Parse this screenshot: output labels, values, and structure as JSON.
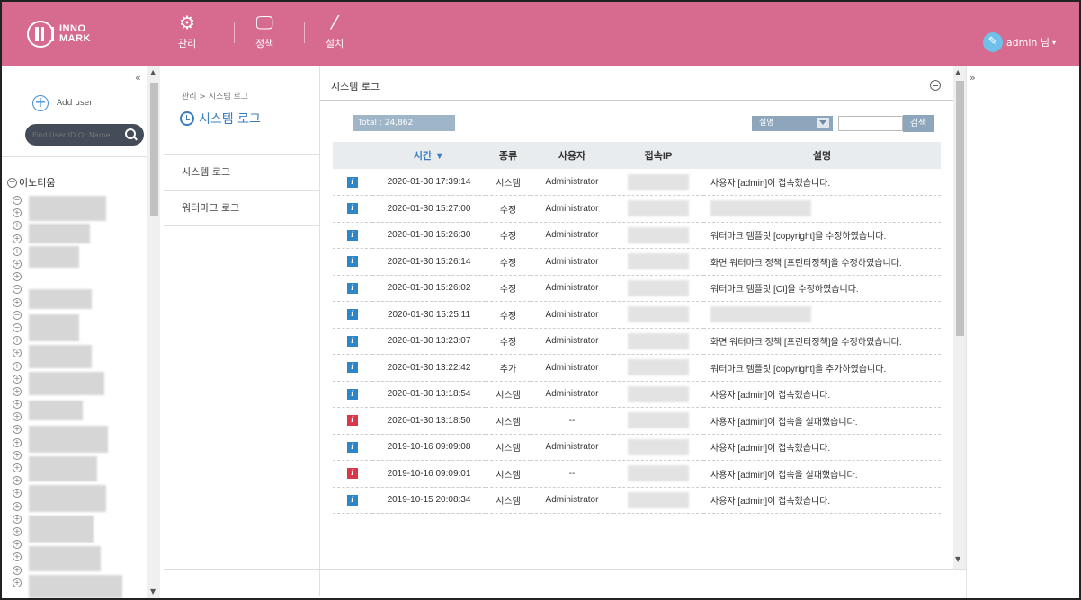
{
  "header": {
    "logo_line1": "INNO",
    "logo_line2": "MARK",
    "nav": [
      {
        "label": "관리",
        "icon": "gear-icon"
      },
      {
        "label": "정책",
        "icon": "monitor-icon"
      },
      {
        "label": "설치",
        "icon": "wand-icon"
      }
    ],
    "user_label": "admin 님",
    "accent_color": "#d66a8f"
  },
  "sidebar": {
    "add_user_label": "Add user",
    "search_placeholder": "Find User ID Or Name",
    "root_label": "이노티움"
  },
  "middle": {
    "breadcrumb": "관리 > 시스템 로그",
    "title": "시스템 로그",
    "menu": [
      "시스템 로그",
      "워터마크 로그"
    ]
  },
  "main": {
    "title": "시스템 로그",
    "total": "Total : 24,862",
    "filter_select": "설명",
    "search_button": "검색",
    "columns": {
      "time": "시간 ▼",
      "type": "종류",
      "user": "사용자",
      "ip": "접속IP",
      "desc": "설명"
    },
    "rows": [
      {
        "level": "info",
        "time": "2020-01-30 17:39:14",
        "type": "시스템",
        "user": "Administrator",
        "desc": "사용자 [admin]이 접속했습니다."
      },
      {
        "level": "info",
        "time": "2020-01-30 15:27:00",
        "type": "수정",
        "user": "Administrator",
        "desc": ""
      },
      {
        "level": "info",
        "time": "2020-01-30 15:26:30",
        "type": "수정",
        "user": "Administrator",
        "desc": "워터마크 템플릿 [copyright]을 수정하였습니다."
      },
      {
        "level": "info",
        "time": "2020-01-30 15:26:14",
        "type": "수정",
        "user": "Administrator",
        "desc": "화면 워터마크 정책 [프린터정책]을 수정하였습니다."
      },
      {
        "level": "info",
        "time": "2020-01-30 15:26:02",
        "type": "수정",
        "user": "Administrator",
        "desc": "워터마크 템플릿 [CI]을 수정하였습니다."
      },
      {
        "level": "info",
        "time": "2020-01-30 15:25:11",
        "type": "수정",
        "user": "Administrator",
        "desc": ""
      },
      {
        "level": "info",
        "time": "2020-01-30 13:23:07",
        "type": "수정",
        "user": "Administrator",
        "desc": "화면 워터마크 정책 [프린터정책]을 수정하였습니다."
      },
      {
        "level": "info",
        "time": "2020-01-30 13:22:42",
        "type": "추가",
        "user": "Administrator",
        "desc": "워터마크 템플릿 [copyright]을 추가하였습니다."
      },
      {
        "level": "info",
        "time": "2020-01-30 13:18:54",
        "type": "시스템",
        "user": "Administrator",
        "desc": "사용자 [admin]이 접속했습니다."
      },
      {
        "level": "error",
        "time": "2020-01-30 13:18:50",
        "type": "시스템",
        "user": "--",
        "desc": "사용자 [admin]이 접속을 실패했습니다."
      },
      {
        "level": "info",
        "time": "2019-10-16 09:09:08",
        "type": "시스템",
        "user": "Administrator",
        "desc": "사용자 [admin]이 접속했습니다."
      },
      {
        "level": "error",
        "time": "2019-10-16 09:09:01",
        "type": "시스템",
        "user": "--",
        "desc": "사용자 [admin]이 접속을 실패했습니다."
      },
      {
        "level": "info",
        "time": "2019-10-15 20:08:34",
        "type": "시스템",
        "user": "Administrator",
        "desc": "사용자 [admin]이 접속했습니다."
      }
    ]
  }
}
